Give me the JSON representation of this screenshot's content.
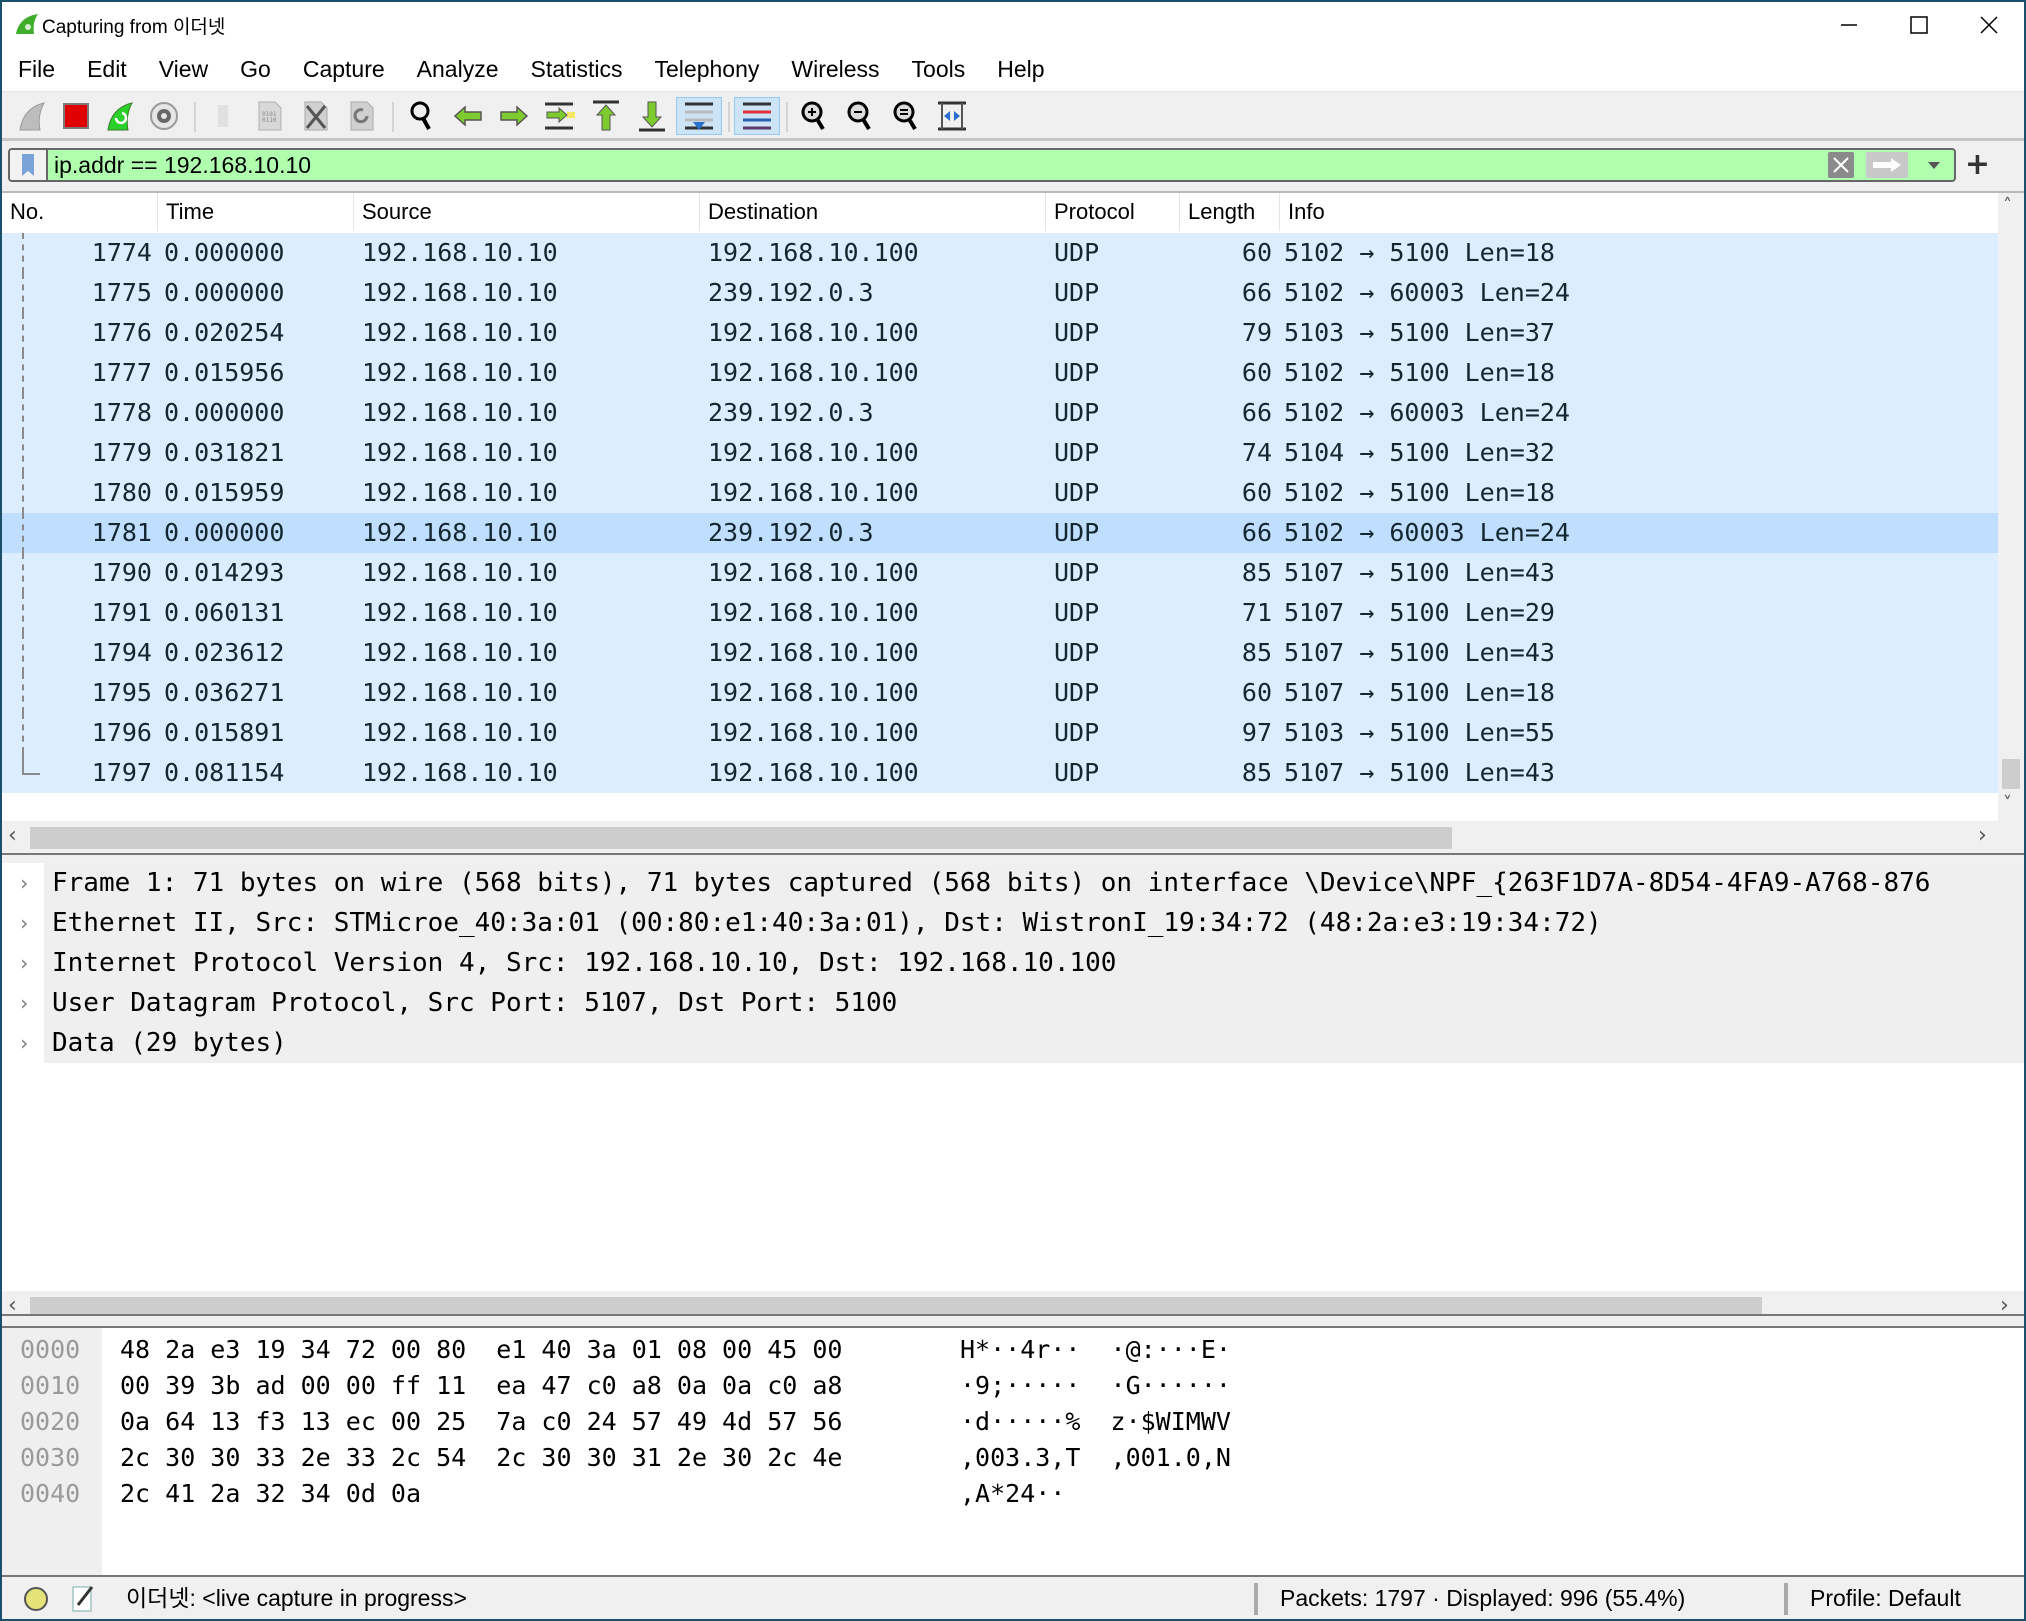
{
  "window": {
    "title": "Capturing from 이더넷",
    "controls": {
      "minimize": "—",
      "maximize": "☐",
      "close": "✕"
    }
  },
  "menu": [
    "File",
    "Edit",
    "View",
    "Go",
    "Capture",
    "Analyze",
    "Statistics",
    "Telephony",
    "Wireless",
    "Tools",
    "Help"
  ],
  "toolbar": {
    "buttons": [
      {
        "name": "start-capture-icon"
      },
      {
        "name": "stop-capture-icon"
      },
      {
        "name": "restart-capture-icon"
      },
      {
        "name": "capture-options-icon"
      },
      {
        "name": "open-file-icon"
      },
      {
        "name": "save-file-icon"
      },
      {
        "name": "close-file-icon"
      },
      {
        "name": "reload-file-icon"
      },
      {
        "name": "find-packet-icon"
      },
      {
        "name": "go-back-icon"
      },
      {
        "name": "go-forward-icon"
      },
      {
        "name": "go-to-packet-icon"
      },
      {
        "name": "go-first-icon"
      },
      {
        "name": "go-last-icon"
      },
      {
        "name": "autoscroll-icon"
      },
      {
        "name": "colorize-icon"
      },
      {
        "name": "zoom-in-icon"
      },
      {
        "name": "zoom-out-icon"
      },
      {
        "name": "zoom-normal-icon"
      },
      {
        "name": "resize-columns-icon"
      }
    ]
  },
  "filter": {
    "value": "ip.addr == 192.168.10.10",
    "background": "#afffaf"
  },
  "packet_list": {
    "columns": [
      "No.",
      "Time",
      "Source",
      "Destination",
      "Protocol",
      "Length",
      "Info"
    ],
    "selected_no": "1781",
    "rows": [
      {
        "no": "1774",
        "time": "0.000000",
        "src": "192.168.10.10",
        "dst": "192.168.10.100",
        "proto": "UDP",
        "len": "60",
        "info": "5102 → 5100 Len=18"
      },
      {
        "no": "1775",
        "time": "0.000000",
        "src": "192.168.10.10",
        "dst": "239.192.0.3",
        "proto": "UDP",
        "len": "66",
        "info": "5102 → 60003 Len=24"
      },
      {
        "no": "1776",
        "time": "0.020254",
        "src": "192.168.10.10",
        "dst": "192.168.10.100",
        "proto": "UDP",
        "len": "79",
        "info": "5103 → 5100 Len=37"
      },
      {
        "no": "1777",
        "time": "0.015956",
        "src": "192.168.10.10",
        "dst": "192.168.10.100",
        "proto": "UDP",
        "len": "60",
        "info": "5102 → 5100 Len=18"
      },
      {
        "no": "1778",
        "time": "0.000000",
        "src": "192.168.10.10",
        "dst": "239.192.0.3",
        "proto": "UDP",
        "len": "66",
        "info": "5102 → 60003 Len=24"
      },
      {
        "no": "1779",
        "time": "0.031821",
        "src": "192.168.10.10",
        "dst": "192.168.10.100",
        "proto": "UDP",
        "len": "74",
        "info": "5104 → 5100 Len=32"
      },
      {
        "no": "1780",
        "time": "0.015959",
        "src": "192.168.10.10",
        "dst": "192.168.10.100",
        "proto": "UDP",
        "len": "60",
        "info": "5102 → 5100 Len=18"
      },
      {
        "no": "1781",
        "time": "0.000000",
        "src": "192.168.10.10",
        "dst": "239.192.0.3",
        "proto": "UDP",
        "len": "66",
        "info": "5102 → 60003 Len=24"
      },
      {
        "no": "1790",
        "time": "0.014293",
        "src": "192.168.10.10",
        "dst": "192.168.10.100",
        "proto": "UDP",
        "len": "85",
        "info": "5107 → 5100 Len=43"
      },
      {
        "no": "1791",
        "time": "0.060131",
        "src": "192.168.10.10",
        "dst": "192.168.10.100",
        "proto": "UDP",
        "len": "71",
        "info": "5107 → 5100 Len=29"
      },
      {
        "no": "1794",
        "time": "0.023612",
        "src": "192.168.10.10",
        "dst": "192.168.10.100",
        "proto": "UDP",
        "len": "85",
        "info": "5107 → 5100 Len=43"
      },
      {
        "no": "1795",
        "time": "0.036271",
        "src": "192.168.10.10",
        "dst": "192.168.10.100",
        "proto": "UDP",
        "len": "60",
        "info": "5107 → 5100 Len=18"
      },
      {
        "no": "1796",
        "time": "0.015891",
        "src": "192.168.10.10",
        "dst": "192.168.10.100",
        "proto": "UDP",
        "len": "97",
        "info": "5103 → 5100 Len=55"
      },
      {
        "no": "1797",
        "time": "0.081154",
        "src": "192.168.10.10",
        "dst": "192.168.10.100",
        "proto": "UDP",
        "len": "85",
        "info": "5107 → 5100 Len=43"
      }
    ],
    "row_color": "#dbedfe",
    "selected_color": "#c0deff"
  },
  "details": [
    "Frame 1: 71 bytes on wire (568 bits), 71 bytes captured (568 bits) on interface \\Device\\NPF_{263F1D7A-8D54-4FA9-A768-876",
    "Ethernet II, Src: STMicroe_40:3a:01 (00:80:e1:40:3a:01), Dst: WistronI_19:34:72 (48:2a:e3:19:34:72)",
    "Internet Protocol Version 4, Src: 192.168.10.10, Dst: 192.168.10.100",
    "User Datagram Protocol, Src Port: 5107, Dst Port: 5100",
    "Data (29 bytes)"
  ],
  "bytes": [
    {
      "offset": "0000",
      "hex": "48 2a e3 19 34 72 00 80  e1 40 3a 01 08 00 45 00",
      "ascii": "H*··4r··  ·@:···E·"
    },
    {
      "offset": "0010",
      "hex": "00 39 3b ad 00 00 ff 11  ea 47 c0 a8 0a 0a c0 a8",
      "ascii": "·9;·····  ·G······"
    },
    {
      "offset": "0020",
      "hex": "0a 64 13 f3 13 ec 00 25  7a c0 24 57 49 4d 57 56",
      "ascii": "·d·····%  z·$WIMWV"
    },
    {
      "offset": "0030",
      "hex": "2c 30 30 33 2e 33 2c 54  2c 30 30 31 2e 30 2c 4e",
      "ascii": ",003.3,T  ,001.0,N"
    },
    {
      "offset": "0040",
      "hex": "2c 41 2a 32 34 0d 0a",
      "ascii": ",A*24··"
    }
  ],
  "status": {
    "capture_text": "이더넷: <live capture in progress>",
    "packets_text": "Packets: 1797 · Displayed: 996 (55.4%)",
    "profile_text": "Profile: Default",
    "packets_total": 1797,
    "packets_displayed": 996,
    "displayed_percent": 55.4
  }
}
